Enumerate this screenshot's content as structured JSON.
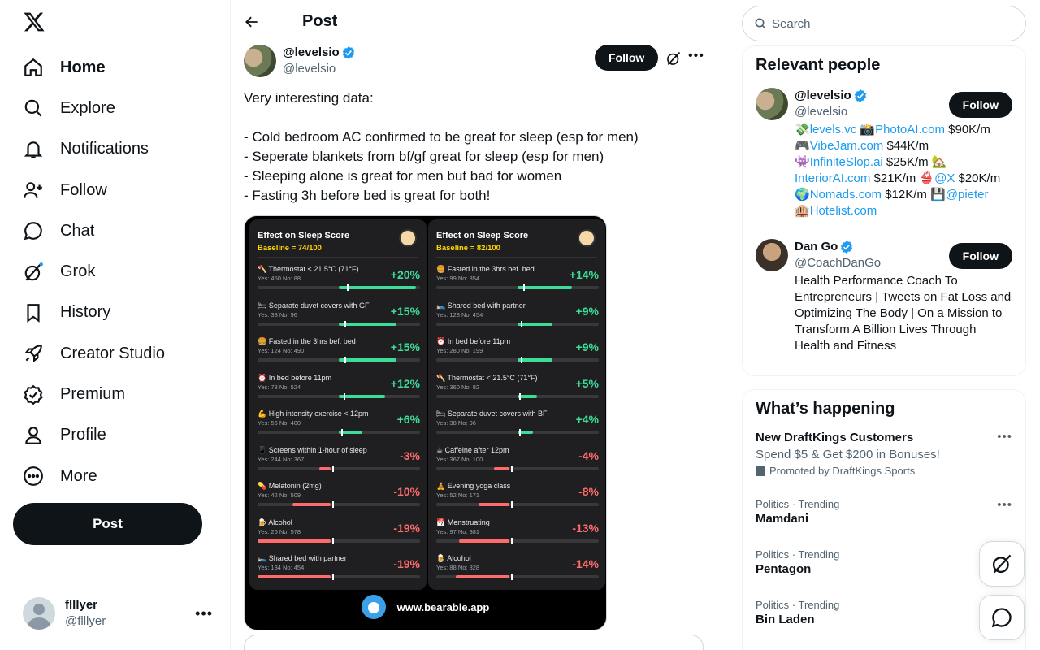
{
  "nav": {
    "items": [
      {
        "label": "Home",
        "icon": "home-icon"
      },
      {
        "label": "Explore",
        "icon": "search-icon"
      },
      {
        "label": "Notifications",
        "icon": "bell-icon"
      },
      {
        "label": "Follow",
        "icon": "add-user-icon"
      },
      {
        "label": "Chat",
        "icon": "chat-icon"
      },
      {
        "label": "Grok",
        "icon": "grok-icon"
      },
      {
        "label": "History",
        "icon": "bookmark-icon"
      },
      {
        "label": "Creator Studio",
        "icon": "rocket-icon"
      },
      {
        "label": "Premium",
        "icon": "premium-icon"
      },
      {
        "label": "Profile",
        "icon": "person-icon"
      },
      {
        "label": "More",
        "icon": "more-circle-icon"
      }
    ],
    "post_label": "Post"
  },
  "account": {
    "name": "flllyer",
    "handle": "@flllyer"
  },
  "header": {
    "title": "Post"
  },
  "post": {
    "author_name": "@levelsio",
    "author_handle": "@levelsio",
    "follow_label": "Follow",
    "text": "Very interesting data:\n\n- Cold bedroom AC confirmed to be great for sleep (esp for men)\n- Seperate blankets from bf/gf great for sleep (esp for men)\n- Sleeping alone is great for men but bad for women\n- Fasting 3h before bed is great for both!"
  },
  "media": {
    "footer": "www.bearable.app",
    "colors": {
      "positive": "#3ddc97",
      "negative": "#ff6b6b"
    },
    "panels": [
      {
        "title": "Effect on Sleep Score",
        "baseline": "Baseline = 74/100",
        "rows": [
          {
            "label": "🪓 Thermostat < 21.5°C (71°F)",
            "counts": "Yes: 450   No: 88",
            "pct": "+20%",
            "value": 20
          },
          {
            "label": "🛏 Separate duvet covers with GF",
            "counts": "Yes: 38   No: 96",
            "pct": "+15%",
            "value": 15
          },
          {
            "label": "🍔 Fasted in the 3hrs bef. bed",
            "counts": "Yes: 124   No: 490",
            "pct": "+15%",
            "value": 15
          },
          {
            "label": "⏰ In bed before 11pm",
            "counts": "Yes: 78   No: 524",
            "pct": "+12%",
            "value": 12
          },
          {
            "label": "💪 High intensity exercise < 12pm",
            "counts": "Yes: 56   No: 400",
            "pct": "+6%",
            "value": 6
          },
          {
            "label": "📱 Screens within 1-hour of sleep",
            "counts": "Yes: 244   No: 367",
            "pct": "-3%",
            "value": -3
          },
          {
            "label": "💊 Melatonin (2mg)",
            "counts": "Yes: 42   No: 509",
            "pct": "-10%",
            "value": -10
          },
          {
            "label": "🍺 Alcohol",
            "counts": "Yes: 26   No: 578",
            "pct": "-19%",
            "value": -19
          },
          {
            "label": "🛌 Shared bed with partner",
            "counts": "Yes: 134   No: 454",
            "pct": "-19%",
            "value": -19
          }
        ]
      },
      {
        "title": "Effect on Sleep Score",
        "baseline": "Baseline = 82/100",
        "rows": [
          {
            "label": "🍔 Fasted in the 3hrs bef. bed",
            "counts": "Yes: 99   No: 354",
            "pct": "+14%",
            "value": 14
          },
          {
            "label": "🛌 Shared bed with partner",
            "counts": "Yes: 128   No: 454",
            "pct": "+9%",
            "value": 9
          },
          {
            "label": "⏰ In bed before 11pm",
            "counts": "Yes: 280   No: 199",
            "pct": "+9%",
            "value": 9
          },
          {
            "label": "🪓 Thermostat < 21.5°C (71°F)",
            "counts": "Yes: 360   No: 82",
            "pct": "+5%",
            "value": 5
          },
          {
            "label": "🛏 Separate duvet covers with BF",
            "counts": "Yes: 38   No: 96",
            "pct": "+4%",
            "value": 4
          },
          {
            "label": "☕ Caffeine after 12pm",
            "counts": "Yes: 367   No: 100",
            "pct": "-4%",
            "value": -4
          },
          {
            "label": "🧘 Evening yoga class",
            "counts": "Yes: 52   No: 171",
            "pct": "-8%",
            "value": -8
          },
          {
            "label": "📅 Menstruating",
            "counts": "Yes: 97   No: 381",
            "pct": "-13%",
            "value": -13
          },
          {
            "label": "🍺 Alcohol",
            "counts": "Yes: 88   No: 328",
            "pct": "-14%",
            "value": -14
          }
        ]
      }
    ]
  },
  "search": {
    "placeholder": "Search"
  },
  "relevant": {
    "title": "Relevant people",
    "people": [
      {
        "name": "@levelsio",
        "handle": "@levelsio",
        "follow": "Follow"
      },
      {
        "name": "Dan Go",
        "handle": "@CoachDanGo",
        "follow": "Follow",
        "bio": "Health Performance Coach To Entrepreneurs | Tweets on Fat Loss and Optimizing The Body | On a Mission to Transform A Billion Lives Through Health and Fitness"
      }
    ],
    "levelsio_bio": {
      "l1_link1": "levels.vc",
      "l1_link2": "PhotoAI.com",
      "l1_amt": " $90K/m",
      "l2_link": "VibeJam.com",
      "l2_amt": " $44K/m",
      "l3_link": "InfiniteSlop.ai",
      "l3_amt": " $25K/m ",
      "l4_link1": "InteriorAI.com",
      "l4_amt1": " $21K/m ",
      "l4_link2": "@X",
      "l4_amt2": " $20K/m",
      "l5_link1": "Nomads.com",
      "l5_amt": " $12K/m ",
      "l5_link2": "@pieter",
      "l6_link": "Hotelist.com"
    }
  },
  "happening": {
    "title": "What’s happening",
    "promo": {
      "name": "New DraftKings Customers",
      "sub": "Spend $5 & Get $200 in Bonuses!",
      "by": "Promoted by DraftKings Sports"
    },
    "trends": [
      {
        "context": "Politics · Trending",
        "name": "Mamdani"
      },
      {
        "context": "Politics · Trending",
        "name": "Pentagon"
      },
      {
        "context": "Politics · Trending",
        "name": "Bin Laden"
      }
    ]
  }
}
